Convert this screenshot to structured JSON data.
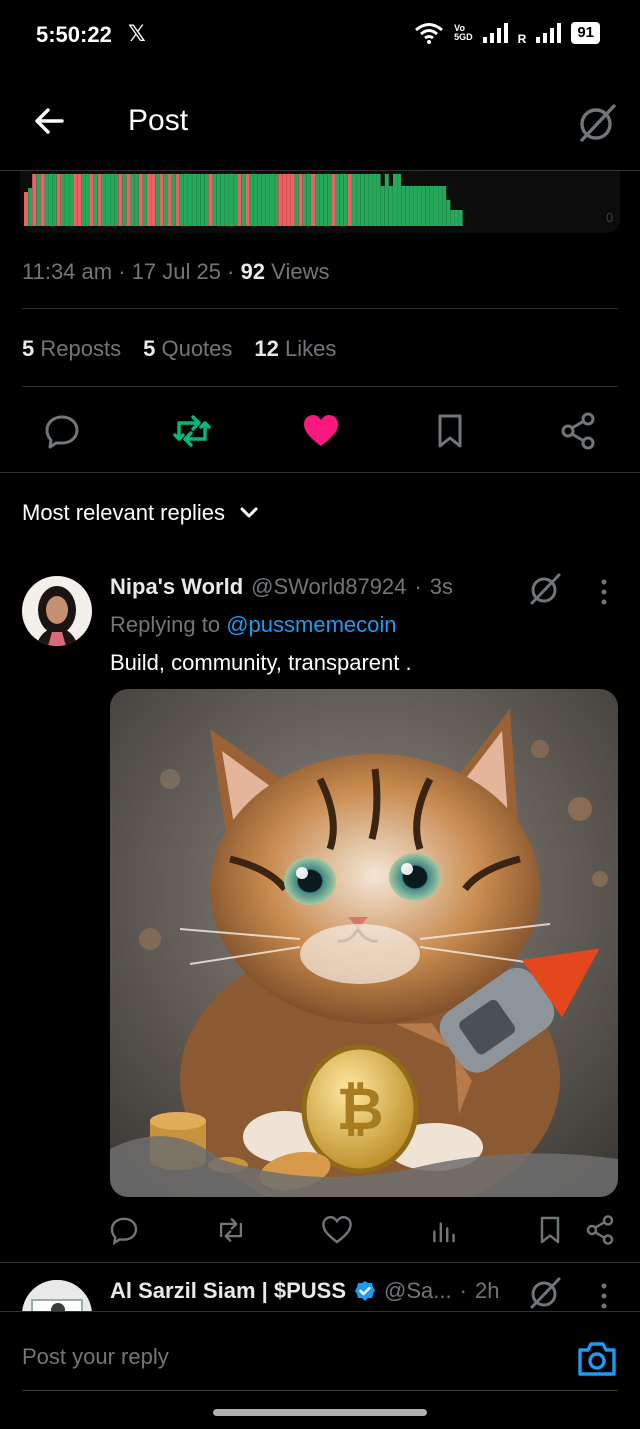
{
  "status_bar": {
    "time": "5:50:22",
    "x_logo": "𝕏",
    "network_volte": "Vo",
    "network_5g": "5G",
    "network_volte_suffix": "D",
    "roaming": "R",
    "battery": "91"
  },
  "header": {
    "title": "Post",
    "back_icon": "arrow-left-icon",
    "grok_icon": "grok-icon"
  },
  "chart_data": {
    "type": "bar",
    "values": [
      -34,
      38,
      -52,
      52,
      -52,
      52,
      52,
      52,
      -52,
      52,
      52,
      52,
      -52,
      -52,
      52,
      52,
      -52,
      52,
      -52,
      52,
      52,
      52,
      52,
      -52,
      52,
      -52,
      52,
      52,
      -52,
      52,
      -52,
      -52,
      52,
      -52,
      52,
      -52,
      52,
      -52,
      52,
      52,
      52,
      52,
      52,
      52,
      52,
      -52,
      52,
      52,
      52,
      52,
      52,
      52,
      -52,
      52,
      -52,
      52,
      52,
      52,
      52,
      52,
      52,
      52,
      -52,
      -52,
      -52,
      -52,
      52,
      -52,
      52,
      52,
      -52,
      52,
      52,
      52,
      52,
      -52,
      52,
      52,
      52,
      -52,
      52,
      52,
      52,
      52,
      52,
      52,
      52,
      40,
      52,
      40,
      52,
      52,
      40,
      40,
      40,
      40,
      40,
      40,
      40,
      40,
      40,
      40,
      40,
      26,
      16,
      16,
      16
    ],
    "colors": {
      "up": "#26a85b",
      "down": "#f05f64"
    },
    "y_tick": "0"
  },
  "post": {
    "time": "11:34 am",
    "date": "17 Jul 25",
    "views_count": "92",
    "views_label": "Views",
    "separator": "·"
  },
  "stats": {
    "reposts_count": "5",
    "reposts_label": "Reposts",
    "quotes_count": "5",
    "quotes_label": "Quotes",
    "likes_count": "12",
    "likes_label": "Likes"
  },
  "actions": {
    "colors": {
      "repost": "#00ba7c",
      "like": "#f91880",
      "default": "#71767b"
    },
    "icons": [
      "reply-icon",
      "repost-icon",
      "like-icon",
      "bookmark-icon",
      "share-icon"
    ]
  },
  "replies": {
    "sort_label": "Most relevant replies",
    "items": [
      {
        "name": "Nipa's World",
        "handle": "@SWorld87924",
        "time": "3s",
        "replying_prefix": "Replying to",
        "replying_to": "@pussmemecoin",
        "text": "Build, community, transparent .",
        "media_alt": "kitten-with-coin-and-rocket-image"
      },
      {
        "name": "Al Sarzil Siam | $PUSS",
        "handle": "@Sa...",
        "time": "2h",
        "verified": true
      }
    ]
  },
  "composer": {
    "placeholder": "Post your reply"
  }
}
